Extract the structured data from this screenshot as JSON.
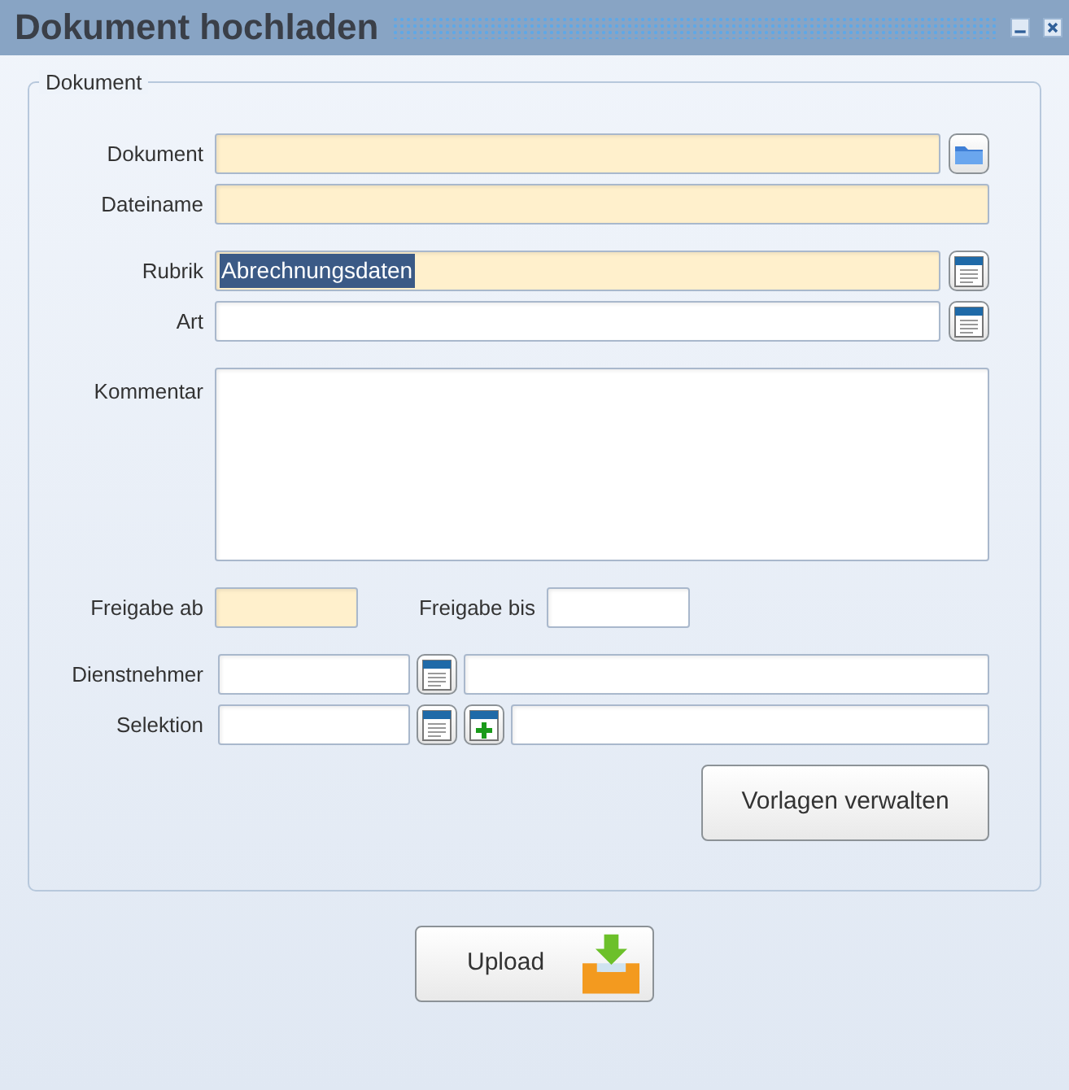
{
  "window": {
    "title": "Dokument hochladen"
  },
  "fieldset": {
    "legend": "Dokument",
    "groups": [
      {
        "rows": [
          {
            "kind": "field",
            "label": "Dokument",
            "required": true,
            "buttons": [
              {
                "kind": "folder"
              }
            ]
          },
          {
            "kind": "field",
            "label": "Dateiname",
            "required": true
          }
        ]
      },
      {
        "rows": [
          {
            "kind": "field",
            "label": "Rubrik",
            "required": true,
            "value": "Abrechnungsdaten",
            "value_selected": true,
            "buttons": [
              {
                "kind": "list"
              }
            ]
          },
          {
            "kind": "field",
            "label": "Art",
            "required": false,
            "buttons": [
              {
                "kind": "list"
              }
            ]
          }
        ]
      },
      {
        "rows": [
          {
            "kind": "textarea",
            "label": "Kommentar",
            "required": false
          }
        ]
      },
      {
        "rows": [
          {
            "kind": "range",
            "fields": [
              {
                "label": "Freigabe ab",
                "required": true
              },
              {
                "label": "Freigabe bis",
                "required": false
              }
            ]
          }
        ]
      },
      {
        "rows": [
          {
            "kind": "lookup",
            "label": "Dienstnehmer",
            "required": false,
            "buttons": [
              {
                "kind": "list"
              }
            ]
          },
          {
            "kind": "lookup",
            "label": "Selektion",
            "required": false,
            "buttons": [
              {
                "kind": "list"
              },
              {
                "kind": "add"
              }
            ]
          }
        ]
      }
    ],
    "manage_button": "Vorlagen verwalten"
  },
  "upload_button": "Upload"
}
